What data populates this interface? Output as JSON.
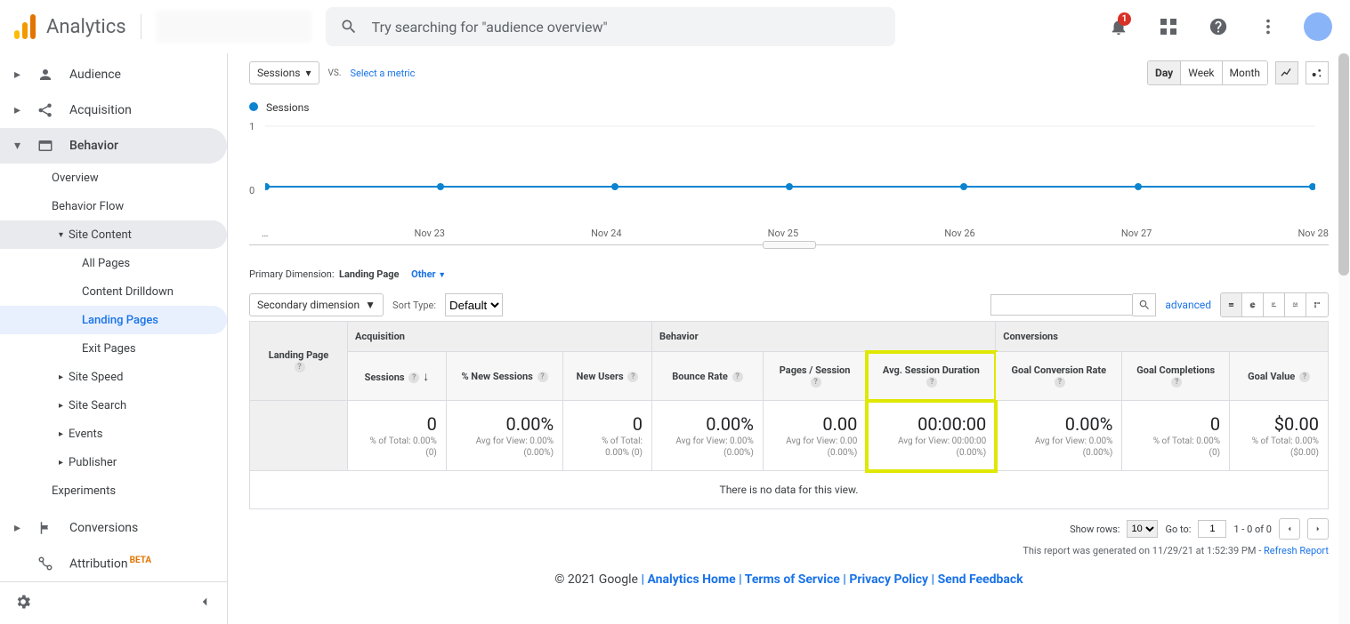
{
  "header": {
    "product": "Analytics",
    "search_placeholder": "Try searching for \"audience overview\"",
    "notification_count": "1"
  },
  "sidebar": {
    "top": [
      {
        "label": "Audience"
      },
      {
        "label": "Acquisition"
      },
      {
        "label": "Behavior"
      }
    ],
    "behavior_children": [
      {
        "label": "Overview"
      },
      {
        "label": "Behavior Flow"
      }
    ],
    "site_content": {
      "label": "Site Content"
    },
    "site_content_children": [
      {
        "label": "All Pages"
      },
      {
        "label": "Content Drilldown"
      },
      {
        "label": "Landing Pages"
      },
      {
        "label": "Exit Pages"
      }
    ],
    "behavior_rest": [
      {
        "label": "Site Speed"
      },
      {
        "label": "Site Search"
      },
      {
        "label": "Events"
      },
      {
        "label": "Publisher"
      },
      {
        "label": "Experiments"
      }
    ],
    "bottom": [
      {
        "label": "Conversions"
      },
      {
        "label": "Attribution",
        "beta": "BETA"
      }
    ]
  },
  "chartbar": {
    "metric_selector": "Sessions",
    "vs": "VS.",
    "select_metric": "Select a metric",
    "granularity": [
      "Day",
      "Week",
      "Month"
    ],
    "series_label": "Sessions",
    "y_max": "1",
    "y_min": "0"
  },
  "chart_data": {
    "type": "line",
    "title": "Sessions",
    "x": [
      "…",
      "Nov 23",
      "Nov 24",
      "Nov 25",
      "Nov 26",
      "Nov 27",
      "Nov 28"
    ],
    "series": [
      {
        "name": "Sessions",
        "values": [
          0,
          0,
          0,
          0,
          0,
          0,
          0
        ]
      }
    ],
    "ylim": [
      0,
      1
    ],
    "xlabel": "",
    "ylabel": ""
  },
  "dimension": {
    "label": "Primary Dimension:",
    "value": "Landing Page",
    "other": "Other"
  },
  "table_toolbar": {
    "secondary": "Secondary dimension",
    "sort_label": "Sort Type:",
    "sort_value": "Default",
    "advanced": "advanced"
  },
  "table": {
    "groups": {
      "c0": "Landing Page",
      "g1": "Acquisition",
      "g2": "Behavior",
      "g3": "Conversions"
    },
    "cols": [
      {
        "label": "Sessions",
        "sort": true
      },
      {
        "label": "% New Sessions"
      },
      {
        "label": "New Users"
      },
      {
        "label": "Bounce Rate"
      },
      {
        "label": "Pages / Session"
      },
      {
        "label": "Avg. Session Duration"
      },
      {
        "label": "Goal Conversion Rate"
      },
      {
        "label": "Goal Completions"
      },
      {
        "label": "Goal Value"
      }
    ],
    "summary": [
      {
        "big": "0",
        "sub1": "% of Total: 0.00%",
        "sub2": "(0)"
      },
      {
        "big": "0.00%",
        "sub1": "Avg for View: 0.00%",
        "sub2": "(0.00%)"
      },
      {
        "big": "0",
        "sub1": "% of Total:",
        "sub2": "0.00% (0)"
      },
      {
        "big": "0.00%",
        "sub1": "Avg for View: 0.00%",
        "sub2": "(0.00%)"
      },
      {
        "big": "0.00",
        "sub1": "Avg for View: 0.00",
        "sub2": "(0.00%)"
      },
      {
        "big": "00:00:00",
        "sub1": "Avg for View: 00:00:00",
        "sub2": "(0.00%)"
      },
      {
        "big": "0.00%",
        "sub1": "Avg for View: 0.00%",
        "sub2": "(0.00%)"
      },
      {
        "big": "0",
        "sub1": "% of Total: 0.00%",
        "sub2": "(0)"
      },
      {
        "big": "$0.00",
        "sub1": "% of Total: 0.00%",
        "sub2": "($0.00)"
      }
    ],
    "nodata": "There is no data for this view."
  },
  "pager": {
    "show_rows": "Show rows:",
    "rows_value": "10",
    "goto": "Go to:",
    "goto_value": "1",
    "range": "1 - 0 of 0"
  },
  "timestamp": {
    "text": "This report was generated on 11/29/21 at 1:52:39 PM - ",
    "refresh": "Refresh Report"
  },
  "footer": {
    "copyright": "© 2021 Google",
    "links": [
      "Analytics Home",
      "Terms of Service",
      "Privacy Policy",
      "Send Feedback"
    ]
  }
}
